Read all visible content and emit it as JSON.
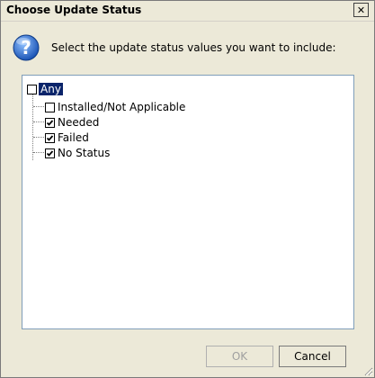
{
  "window": {
    "title": "Choose Update Status",
    "close_label": "✕"
  },
  "prompt": "Select the update status values you want to include:",
  "tree": {
    "root": {
      "label": "Any",
      "checked": false,
      "selected": true
    },
    "children": [
      {
        "label": "Installed/Not Applicable",
        "checked": false
      },
      {
        "label": "Needed",
        "checked": true
      },
      {
        "label": "Failed",
        "checked": true
      },
      {
        "label": "No Status",
        "checked": true
      }
    ]
  },
  "buttons": {
    "ok_label": "OK",
    "cancel_label": "Cancel"
  },
  "icons": {
    "help": "help-question-icon",
    "check": "checkmark-icon",
    "grip": "resize-grip-icon"
  },
  "colors": {
    "help_icon": "#2f6fc9",
    "selection": "#0a246a"
  }
}
